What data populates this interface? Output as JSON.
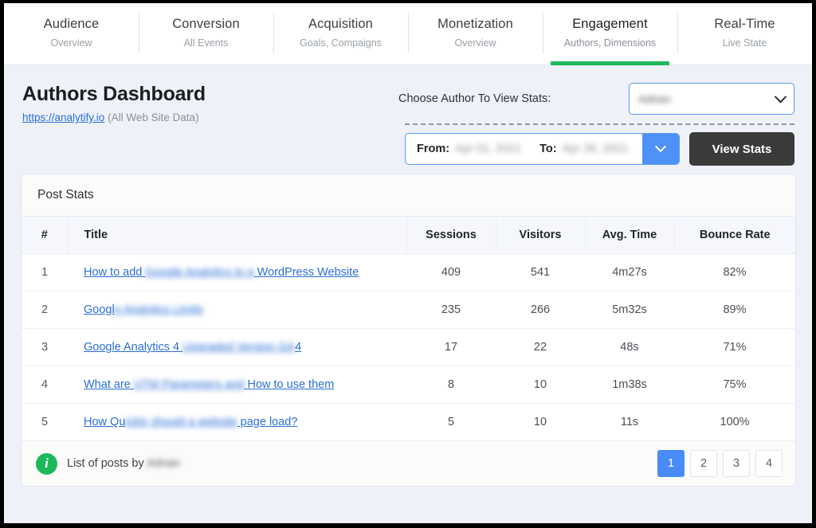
{
  "tabs": [
    {
      "title": "Audience",
      "sub": "Overview",
      "active": false
    },
    {
      "title": "Conversion",
      "sub": "All Events",
      "active": false
    },
    {
      "title": "Acquisition",
      "sub": "Goals, Compaigns",
      "active": false
    },
    {
      "title": "Monetization",
      "sub": "Overview",
      "active": false
    },
    {
      "title": "Engagement",
      "sub": "Authors, Dimensions",
      "active": true
    },
    {
      "title": "Real-Time",
      "sub": "Live State",
      "active": false
    }
  ],
  "header": {
    "title": "Authors Dashboard",
    "site_url": "https://analytify.io",
    "site_scope": "(All Web Site Data)"
  },
  "controls": {
    "choose_author_label": "Choose Author To View Stats:",
    "author_selected": "Adnan",
    "from_label": "From:",
    "from_value": "Apr 01, 2021",
    "to_label": "To:",
    "to_value": "Apr 26, 2021",
    "view_stats_label": "View Stats"
  },
  "card": {
    "heading": "Post Stats",
    "columns": {
      "num": "#",
      "title": "Title",
      "sessions": "Sessions",
      "visitors": "Visitors",
      "avg_time": "Avg. Time",
      "bounce_rate": "Bounce Rate"
    },
    "rows": [
      {
        "num": "1",
        "title_pre": "How to add ",
        "title_blur": "Google Analytics to a",
        "title_post": " WordPress Website",
        "sessions": "409",
        "visitors": "541",
        "avg_time": "4m27s",
        "bounce_rate": "82%"
      },
      {
        "num": "2",
        "title_pre": "Googl",
        "title_blur": "e Analytics Limits",
        "title_post": "",
        "sessions": "235",
        "visitors": "266",
        "avg_time": "5m32s",
        "bounce_rate": "89%"
      },
      {
        "num": "3",
        "title_pre": "Google Analytics 4 ",
        "title_blur": "Upgraded Version GA",
        "title_post": "4",
        "sessions": "17",
        "visitors": "22",
        "avg_time": "48s",
        "bounce_rate": "71%"
      },
      {
        "num": "4",
        "title_pre": "What are ",
        "title_blur": "UTM Parameters and",
        "title_post": " How to use them",
        "sessions": "8",
        "visitors": "10",
        "avg_time": "1m38s",
        "bounce_rate": "75%"
      },
      {
        "num": "5",
        "title_pre": "How Qu",
        "title_blur": "ickly should a website",
        "title_post": " page load?",
        "sessions": "5",
        "visitors": "10",
        "avg_time": "11s",
        "bounce_rate": "100%"
      }
    ],
    "footer": {
      "info_glyph": "i",
      "text_pre": "List of posts by ",
      "author_blur": "Adnan",
      "pages": [
        "1",
        "2",
        "3",
        "4"
      ],
      "active_page": "1"
    }
  },
  "colors": {
    "accent_green": "#1eb95a",
    "accent_blue": "#4a8cf7",
    "link_blue": "#2a6fd6",
    "dark_button": "#3b3b3b",
    "page_bg": "#eef1f8"
  }
}
